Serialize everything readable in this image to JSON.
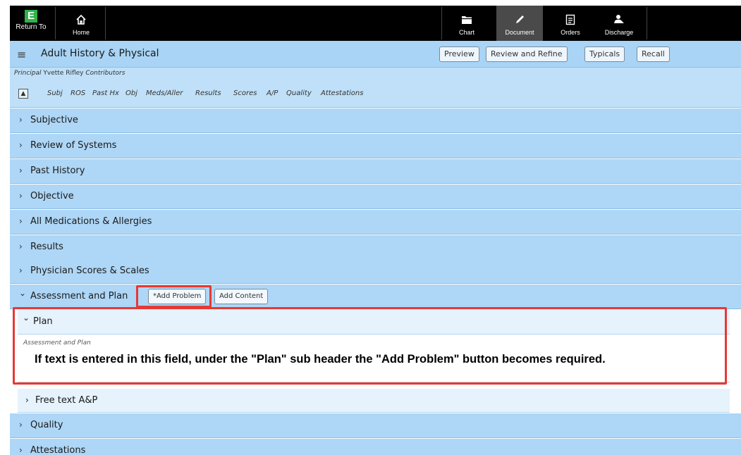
{
  "topbar": {
    "return_to": {
      "badge": "E",
      "label": "Return To"
    },
    "home": {
      "label": "Home"
    },
    "chart": {
      "label": "Chart"
    },
    "document": {
      "label": "Document"
    },
    "orders": {
      "label": "Orders"
    },
    "discharge": {
      "label": "Discharge"
    }
  },
  "header": {
    "title": "Adult History & Physical",
    "buttons": {
      "preview": "Preview",
      "review_refine": "Review and Refine",
      "typicals": "Typicals",
      "recall": "Recall"
    }
  },
  "principal": {
    "prefix": "Principal",
    "name": "Yvette Rifley",
    "suffix": "Contributors"
  },
  "nav": {
    "links": [
      "Subj",
      "ROS",
      "Past Hx",
      "Obj",
      "Meds/Aller",
      "Results",
      "Scores",
      "A/P",
      "Quality",
      "Attestations"
    ]
  },
  "sections": [
    {
      "label": "Subjective"
    },
    {
      "label": "Review of Systems"
    },
    {
      "label": "Past History"
    },
    {
      "label": "Objective"
    },
    {
      "label": "All Medications & Allergies"
    },
    {
      "label": "Results"
    },
    {
      "label": "Physician Scores & Scales"
    },
    {
      "label": "Assessment and Plan"
    },
    {
      "label": "Quality"
    },
    {
      "label": "Attestations"
    }
  ],
  "ap_buttons": {
    "add_problem": "*Add Problem",
    "add_content": "Add Content"
  },
  "plan": {
    "header": "Plan",
    "field_label": "Assessment and Plan",
    "field_text": "If text is entered in this field, under the \"Plan\" sub header the \"Add Problem\" button becomes required."
  },
  "free_text": {
    "label": "Free text A&P"
  },
  "icons": {
    "section_collapsed": "›",
    "section_expanded": "⌄",
    "hamburger": "≡"
  },
  "colors": {
    "section_bg": "#aed6f6",
    "highlight": "#e53935",
    "topbar": "#000000"
  }
}
